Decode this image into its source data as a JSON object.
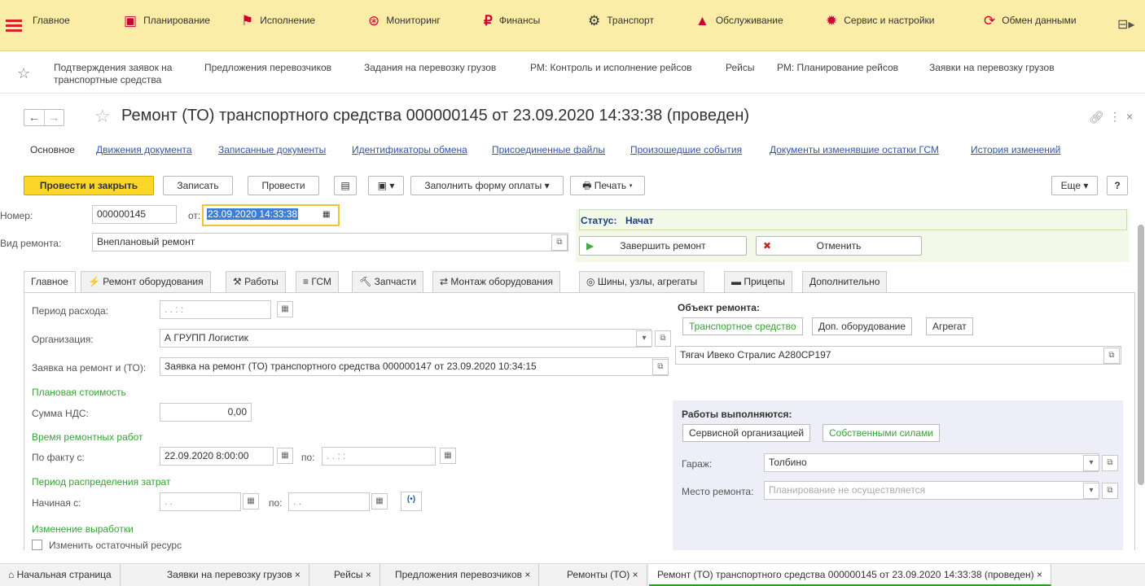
{
  "menu": {
    "items": [
      "Главное",
      "Планирование",
      "Исполнение",
      "Мониторинг",
      "Финансы",
      "Транспорт",
      "Обслуживание",
      "Сервис и настройки",
      "Обмен данными"
    ]
  },
  "quick": {
    "links": [
      "Подтверждения заявок на транспортные средства",
      "Предложения перевозчиков",
      "Задания на перевозку грузов",
      "РМ: Контроль и исполнение рейсов",
      "Рейсы",
      "РМ: Планирование рейсов",
      "Заявки на перевозку грузов"
    ]
  },
  "doc": {
    "title": "Ремонт (ТО) транспортного средства 000000145 от 23.09.2020 14:33:38 (проведен)"
  },
  "doctabs": [
    "Основное",
    "Движения документа",
    "Записанные документы",
    "Идентификаторы обмена",
    "Присоединенные файлы",
    "Произошедшие события",
    "Документы изменявшие остатки ГСМ",
    "История изменений"
  ],
  "toolbar": {
    "post_close": "Провести и закрыть",
    "save": "Записать",
    "post": "Провести",
    "fill_payment": "Заполнить форму оплаты",
    "print": "Печать",
    "more": "Еще",
    "help": "?"
  },
  "header": {
    "number_label": "Номер:",
    "number": "000000145",
    "from_label": "от:",
    "date": "23.09.2020 14:33:38",
    "repair_type_label": "Вид ремонта:",
    "repair_type": "Внеплановый ремонт",
    "status_label": "Статус:",
    "status": "Начат",
    "finish_btn": "Завершить ремонт",
    "cancel_btn": "Отменить"
  },
  "formtabs": [
    "Главное",
    "Ремонт оборудования",
    "Работы",
    "ГСМ",
    "Запчасти",
    "Монтаж оборудования",
    "Шины, узлы, агрегаты",
    "Прицепы",
    "Дополнительно"
  ],
  "main": {
    "period_label": "Период расхода:",
    "period_value": " .  .      :  :",
    "org_label": "Организация:",
    "org_value": "А ГРУПП Логистик",
    "request_label": "Заявка на ремонт и (ТО):",
    "request_value": "Заявка на ремонт (ТО) транспортного средства 000000147 от 23.09.2020 10:34:15",
    "planned_cost": "Плановая стоимость",
    "vat_label": "Сумма НДС:",
    "vat_value": "0,00",
    "repair_time": "Время ремонтных работ",
    "fact_from_label": "По факту с:",
    "fact_from": "22.09.2020  8:00:00",
    "to_label": "по:",
    "fact_to": " .  .      :  :",
    "dist_period": "Период распределения затрат",
    "start_label": "Начиная с:",
    "start_value": " .  .",
    "dist_to": " .  .",
    "output_change": "Изменение выработки",
    "change_resource": "Изменить остаточный ресурс"
  },
  "object": {
    "title": "Объект ремонта:",
    "seg": [
      "Транспортное средство",
      "Доп. оборудование",
      "Агрегат"
    ],
    "value": "Тягач Ивеко Стралис А280СР197"
  },
  "works": {
    "title": "Работы выполняются:",
    "seg": [
      "Сервисной организацией",
      "Собственными силами"
    ],
    "garage_label": "Гараж:",
    "garage": "Толбино",
    "place_label": "Место ремонта:",
    "place_placeholder": "Планирование не осуществляется"
  },
  "bottomtabs": [
    "Начальная страница",
    "Заявки на перевозку грузов",
    "Рейсы",
    "Предложения перевозчиков",
    "Ремонты (ТО)",
    "Ремонт (ТО) транспортного средства 000000145 от 23.09.2020 14:33:38 (проведен)"
  ],
  "colors": {
    "accent": "#fcd62b",
    "menu_bg": "#fbeca8",
    "link": "#3355aa",
    "green": "#36a336"
  }
}
